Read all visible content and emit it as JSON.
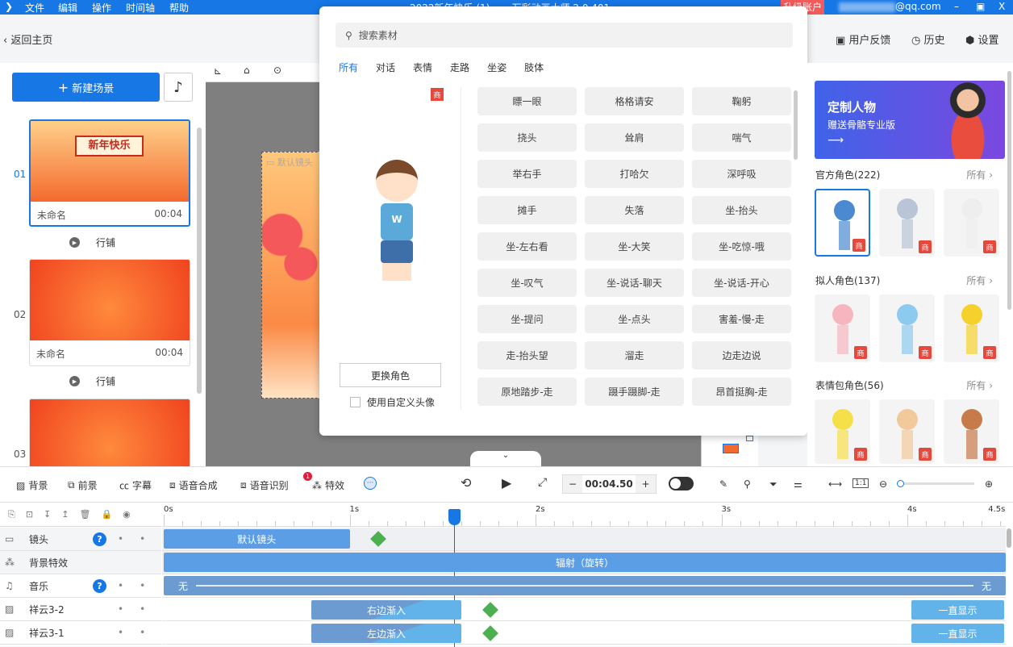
{
  "titlebar": {
    "menu": [
      "文件",
      "编辑",
      "操作",
      "时间轴",
      "帮助"
    ],
    "title": "2022新年快乐 (1) ... - 万彩动画大师 2.0.401",
    "upgrade": "升级账户",
    "account": "@qq.com",
    "bg": "#1677e5"
  },
  "topbar": {
    "back": "返回主页",
    "feedback": "用户反馈",
    "history": "历史",
    "settings": "设置"
  },
  "left": {
    "new_scene": "新建场景",
    "scenes": [
      {
        "num": "01",
        "name": "未命名",
        "duration": "00:04",
        "transition": "行铺",
        "thumb_text": "新年快乐"
      },
      {
        "num": "02",
        "name": "未命名",
        "duration": "00:04",
        "transition": "行铺"
      },
      {
        "num": "03"
      }
    ]
  },
  "canvas": {
    "camera_label": "默认镜头"
  },
  "popup": {
    "search_placeholder": "搜索素材",
    "tabs": [
      "所有",
      "对话",
      "表情",
      "走路",
      "坐姿",
      "肢体"
    ],
    "badge": "商",
    "change_role": "更换角色",
    "custom_avatar": "使用自定义头像",
    "actions": [
      "瞟一眼",
      "格格请安",
      "鞠躬",
      "挠头",
      "耸肩",
      "喘气",
      "举右手",
      "打哈欠",
      "深呼吸",
      "摊手",
      "失落",
      "坐-抬头",
      "坐-左右看",
      "坐-大笑",
      "坐-吃惊-哦",
      "坐-叹气",
      "坐-说话-聊天",
      "坐-说话-开心",
      "坐-提问",
      "坐-点头",
      "害羞-慢-走",
      "走-抬头望",
      "溜走",
      "边走边说",
      "原地踏步-走",
      "蹑手蹑脚-走",
      "昂首挺胸-走"
    ]
  },
  "right": {
    "banner_line1": "定制人物",
    "banner_line2": "赠送骨骼专业版",
    "sections": [
      {
        "title": "官方角色(222)",
        "more": "所有 ›"
      },
      {
        "title": "拟人角色(137)",
        "more": "所有 ›"
      },
      {
        "title": "表情包角色(56)",
        "more": "所有 ›"
      }
    ],
    "badge": "商"
  },
  "bottombar": {
    "items": [
      "背景",
      "前景",
      "字幕",
      "语音合成",
      "语音识别",
      "特效"
    ],
    "notif": "1",
    "time": "00:04.50"
  },
  "timeline": {
    "ruler": [
      "0s",
      "1s",
      "2s",
      "3s",
      "4s",
      "4.5s"
    ],
    "playhead_s": 1.56,
    "tracks": [
      {
        "name": "镜头",
        "icon": "camera-icon",
        "help": "?"
      },
      {
        "name": "背景特效",
        "icon": "effect-icon"
      },
      {
        "name": "音乐",
        "icon": "music-icon",
        "help": "?"
      },
      {
        "name": "祥云3-2",
        "icon": "image-icon"
      },
      {
        "name": "祥云3-1",
        "icon": "image-icon"
      }
    ],
    "clips": {
      "camera": "默认镜头",
      "bg_effect": "辐射（旋转）",
      "music_in": "无",
      "music_out": "无",
      "c32_in": "右边渐入",
      "c32_out": "一直显示",
      "c31_in": "左边渐入",
      "c31_out": "一直显示"
    }
  }
}
